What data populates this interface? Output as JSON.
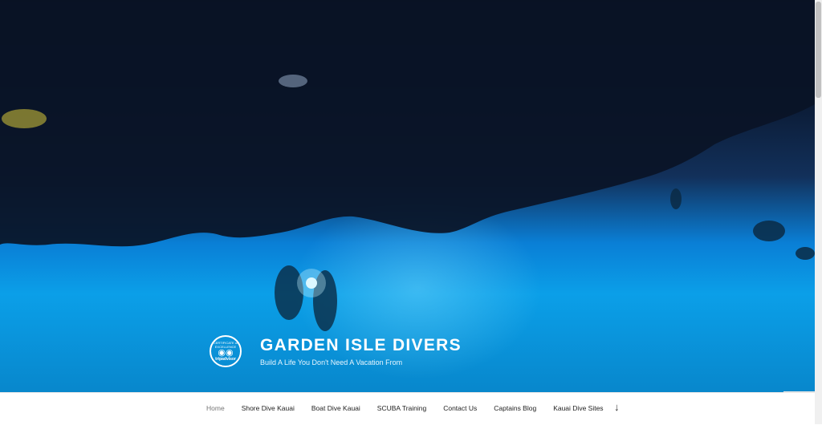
{
  "site": {
    "title": "GARDEN ISLE DIVERS",
    "tagline": "Build A Life You Don't Need A Vacation From"
  },
  "badge": {
    "line1": "CERTIFICATE of",
    "line2": "EXCELLENCE",
    "brand": "tripadvisor",
    "icon": "owl-eyes-icon"
  },
  "nav": {
    "items": [
      {
        "label": "Home",
        "current": true
      },
      {
        "label": "Shore Dive Kauai"
      },
      {
        "label": "Boat Dive Kauai"
      },
      {
        "label": "SCUBA Training"
      },
      {
        "label": "Contact Us"
      },
      {
        "label": "Captains Blog"
      },
      {
        "label": "Kauai Dive Sites"
      }
    ],
    "scroll_down_icon": "↓"
  },
  "colors": {
    "hero_dark": "#060b18",
    "hero_water": "#0b9fe8",
    "nav_bg": "#ffffff",
    "nav_text": "#222222",
    "nav_current": "#767676"
  }
}
